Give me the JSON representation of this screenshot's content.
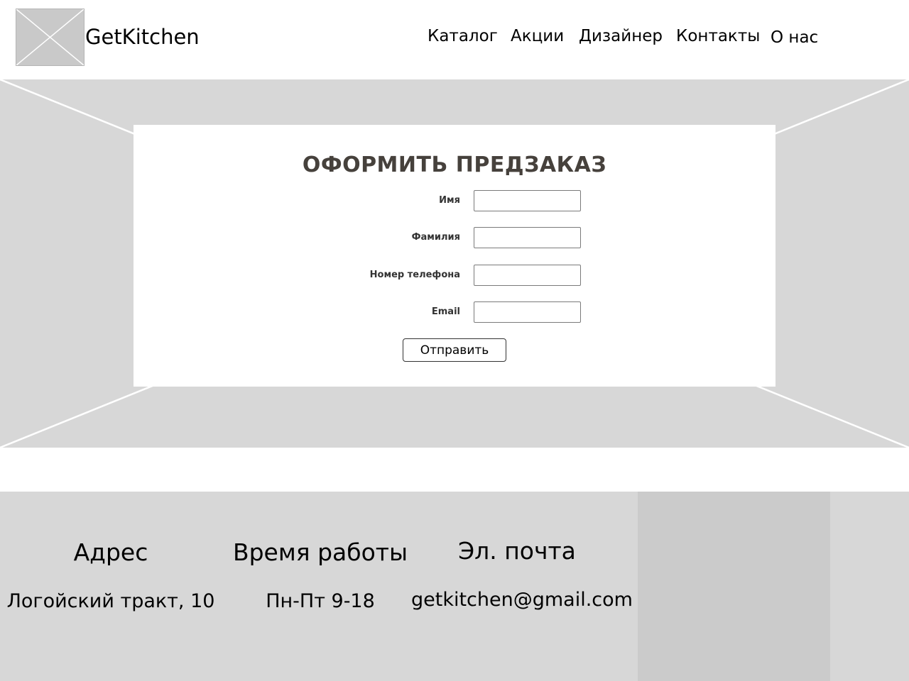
{
  "header": {
    "brand": "GetKitchen",
    "nav": [
      {
        "label": "Каталог"
      },
      {
        "label": "Акции"
      },
      {
        "label": "Дизайнер"
      },
      {
        "label": "Контакты"
      },
      {
        "label": "О нас"
      }
    ]
  },
  "preorder_form": {
    "title": "ОФОРМИТЬ ПРЕДЗАКАЗ",
    "fields": [
      {
        "label": "Имя",
        "value": ""
      },
      {
        "label": "Фамилия",
        "value": ""
      },
      {
        "label": "Номер телефона",
        "value": ""
      },
      {
        "label": "Email",
        "value": ""
      }
    ],
    "submit_label": "Отправить"
  },
  "footer": {
    "columns": [
      {
        "heading": "Адрес",
        "value": "Логойский тракт, 10"
      },
      {
        "heading": "Время работы",
        "value": "Пн-Пт 9-18"
      },
      {
        "heading": "Эл. почта",
        "value": "getkitchen@gmail.com"
      }
    ]
  },
  "colors": {
    "placeholder_gray": "#d7d7d7",
    "map_gray": "#cbcbcb",
    "title_color": "#46413c"
  }
}
